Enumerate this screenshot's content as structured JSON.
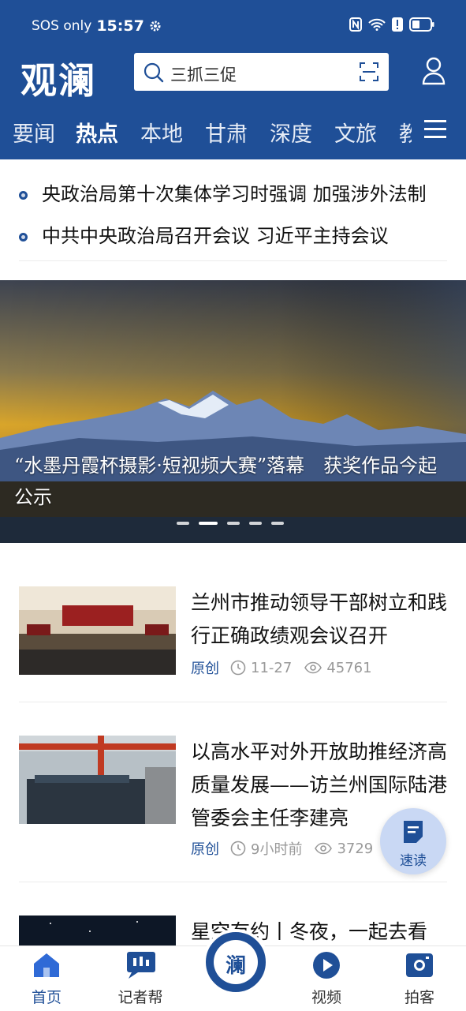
{
  "status": {
    "sos": "SOS only",
    "time": "15:57"
  },
  "header": {
    "logo": "观澜",
    "search_text": "三抓三促"
  },
  "tabs": [
    "要闻",
    "热点",
    "本地",
    "甘肃",
    "深度",
    "文旅",
    "教"
  ],
  "active_tab": "热点",
  "ticker": [
    "央政治局第十次集体学习时强调 加强涉外法制",
    "中共中央政治局召开会议 习近平主持会议"
  ],
  "banner": {
    "caption": "“水墨丹霞杯摄影·短视频大赛”落幕　获奖作品今起公示",
    "slide_count": 5,
    "active_slide": 2
  },
  "articles": [
    {
      "title": "兰州市推动领导干部树立和践行正确政绩观会议召开",
      "tag": "原创",
      "time": "11-27",
      "views": "45761"
    },
    {
      "title": "以高水平对外开放助推经济高质量发展——访兰州国际陆港管委会主任李建亮",
      "tag": "原创",
      "time": "9小时前",
      "views": "3729"
    },
    {
      "title": "星空有约丨冬夜，一起去看"
    }
  ],
  "fab": {
    "label": "速读"
  },
  "bottom_nav": [
    {
      "label": "首页",
      "icon": "home-icon"
    },
    {
      "label": "记者帮",
      "icon": "reporter-chat-icon"
    },
    {
      "label": "",
      "icon": "lan-center-icon",
      "char": "澜"
    },
    {
      "label": "视频",
      "icon": "play-icon"
    },
    {
      "label": "拍客",
      "icon": "camera-icon"
    }
  ],
  "colors": {
    "brand": "#1f4f97",
    "fab_bg": "#c9d8f4"
  }
}
